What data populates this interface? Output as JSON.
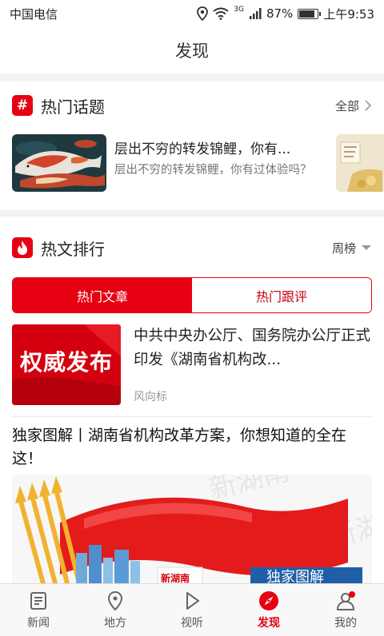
{
  "status_bar": {
    "carrier": "中国电信",
    "network": "3G",
    "battery": "87%",
    "battery_level": 0.87,
    "time": "上午9:53"
  },
  "header": {
    "title": "发现"
  },
  "hot_topics": {
    "icon_glyph": "#",
    "title": "热门话题",
    "more_label": "全部",
    "items": [
      {
        "title": "层出不穷的转发锦鲤，你有...",
        "desc": "层出不穷的转发锦鲤，你有过体验吗？"
      }
    ]
  },
  "hot_articles": {
    "title": "热文排行",
    "filter_label": "周榜",
    "tabs": [
      "热门文章",
      "热门跟评"
    ],
    "active_tab": 0,
    "items": [
      {
        "thumb_text": "权威发布",
        "title": "中共中央办公厅、国务院办公厅正式印发《湖南省机构改...",
        "source": "风向标"
      },
      {
        "title": "独家图解丨湖南省机构改革方案，你想知道的全在这！",
        "image_banner_text": "独家图解",
        "image_logo_text": "新湖南",
        "image_watermark": "新湖南"
      }
    ]
  },
  "bottom_nav": {
    "items": [
      {
        "label": "新闻",
        "icon": "news-icon"
      },
      {
        "label": "地方",
        "icon": "location-icon"
      },
      {
        "label": "视听",
        "icon": "play-icon"
      },
      {
        "label": "发现",
        "icon": "compass-icon"
      },
      {
        "label": "我的",
        "icon": "profile-icon"
      }
    ],
    "active_index": 3
  },
  "colors": {
    "accent": "#e60012",
    "background": "#ffffff",
    "section_gap": "#f2f2f2"
  }
}
